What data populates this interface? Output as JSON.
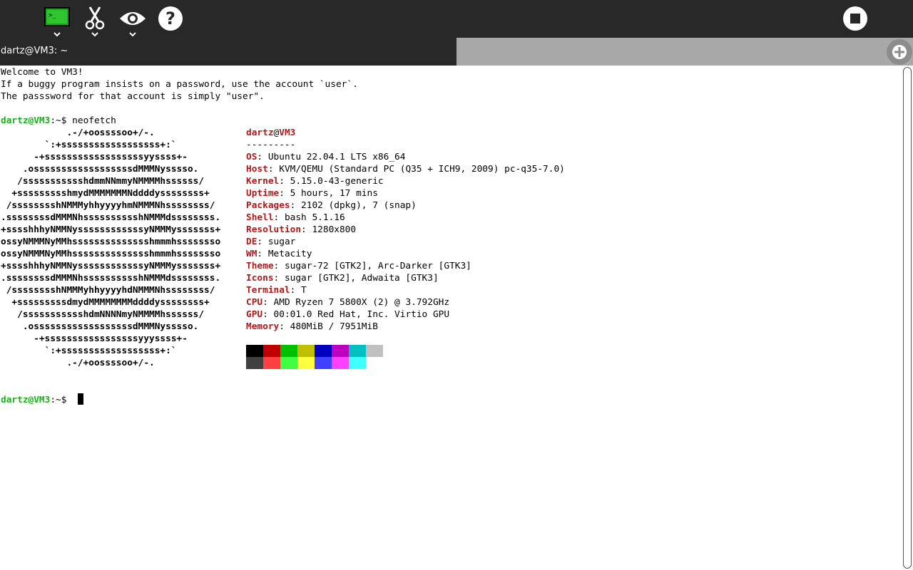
{
  "tab": {
    "title": "dartz@VM3: ~"
  },
  "toolbar": {
    "icons": [
      "terminal-activity-icon",
      "scissors-icon",
      "eye-icon",
      "help-icon",
      "stop-icon"
    ]
  },
  "colors": {
    "toolbar_bg": "#282828",
    "prompt_green": "#18b218",
    "logo_red": "#b21818"
  },
  "terminal": {
    "welcome": "Welcome to VM3!\nIf a buggy program insists on a password, use the account `user`.\nThe passsword for that account is simply \"user\".",
    "prompt": {
      "user_host": "dartz@VM3",
      "path": ":~$ ",
      "command": "neofetch"
    },
    "logo_lines": [
      "            .-/+oossssoo+/-.",
      "        `:+ssssssssssssssssss+:`",
      "      -+ssssssssssssssssssyyssss+-",
      "    .ossssssssssssssssssdMMMNysssso.",
      "   /ssssssssssshdmmNNmmyNMMMMhssssss/",
      "  +ssssssssshmydMMMMMMMNddddyssssssss+",
      " /sssssssshNMMMyhhyyyyhmNMMMNhssssssss/",
      ".ssssssssdMMMNhsssssssssshNMMMdssssssss.",
      "+sssshhhyNMMNyssssssssssssyNMMMysssssss+",
      "ossyNMMMNyMMhsssssssssssssshmmmhssssssso",
      "ossyNMMMNyMMhsssssssssssssshmmmhssssssso",
      "+sssshhhyNMMNyssssssssssssyNMMMysssssss+",
      ".ssssssssdMMMNhsssssssssshNMMMdssssssss.",
      " /sssssssshNMMMyhhyyyyhdNMMMNhssssssss/",
      "  +sssssssssdmydMMMMMMMMddddyssssssss+",
      "   /ssssssssssshdmNNNNmyNMMMMhssssss/",
      "    .ossssssssssssssssssdMMMNysssso.",
      "      -+sssssssssssssssssyyyssss+-",
      "        `:+ssssssssssssssssss+:`",
      "            .-/+oossssoo+/-."
    ],
    "info": {
      "user": "dartz",
      "at": "@",
      "host": "VM3",
      "separator": "---------",
      "rows": [
        {
          "key": "OS",
          "value": ": Ubuntu 22.04.1 LTS x86_64"
        },
        {
          "key": "Host",
          "value": ": KVM/QEMU (Standard PC (Q35 + ICH9, 2009) pc-q35-7.0)"
        },
        {
          "key": "Kernel",
          "value": ": 5.15.0-43-generic"
        },
        {
          "key": "Uptime",
          "value": ": 5 hours, 17 mins"
        },
        {
          "key": "Packages",
          "value": ": 2102 (dpkg), 7 (snap)"
        },
        {
          "key": "Shell",
          "value": ": bash 5.1.16"
        },
        {
          "key": "Resolution",
          "value": ": 1280x800"
        },
        {
          "key": "DE",
          "value": ": sugar"
        },
        {
          "key": "WM",
          "value": ": Metacity"
        },
        {
          "key": "Theme",
          "value": ": sugar-72 [GTK2], Arc-Darker [GTK3]"
        },
        {
          "key": "Icons",
          "value": ": sugar [GTK2], Adwaita [GTK3]"
        },
        {
          "key": "Terminal",
          "value": ": T"
        },
        {
          "key": "CPU",
          "value": ": AMD Ryzen 7 5800X (2) @ 3.792GHz"
        },
        {
          "key": "GPU",
          "value": ": 00:01.0 Red Hat, Inc. Virtio GPU"
        },
        {
          "key": "Memory",
          "value": ": 480MiB / 7951MiB"
        }
      ]
    },
    "palette_row1": [
      "#000000",
      "#c00000",
      "#00c000",
      "#c0c000",
      "#0000c0",
      "#c000c0",
      "#00c0c0",
      "#c0c0c0"
    ],
    "palette_row2": [
      "#404040",
      "#ff4040",
      "#40ff40",
      "#ffff40",
      "#4040ff",
      "#ff40ff",
      "#40ffff"
    ]
  }
}
